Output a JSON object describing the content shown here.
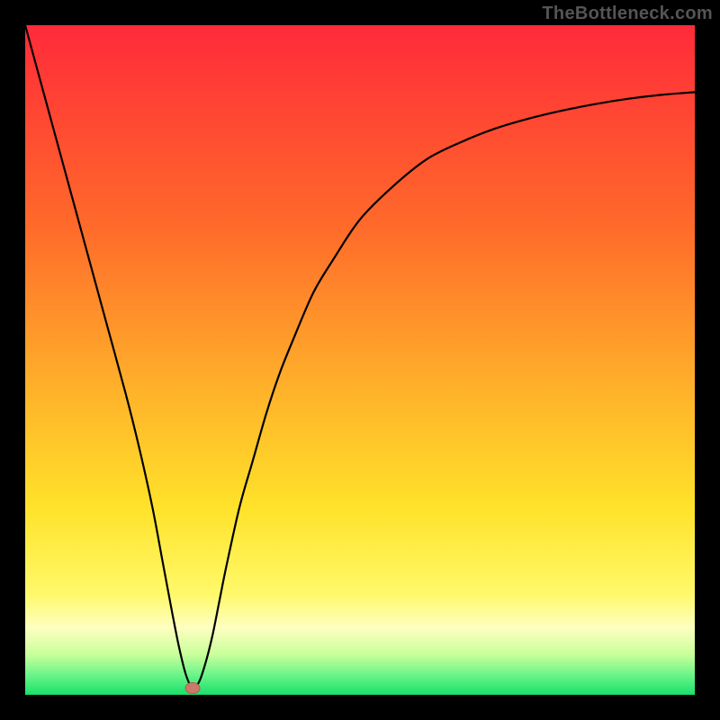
{
  "watermark": "TheBottleneck.com",
  "chart_data": {
    "type": "line",
    "title": "",
    "xlabel": "",
    "ylabel": "",
    "xlim": [
      0,
      100
    ],
    "ylim": [
      0,
      100
    ],
    "grid": false,
    "legend": false,
    "series": [
      {
        "name": "curve",
        "x": [
          0,
          3,
          6,
          9,
          12,
          15,
          17,
          19,
          20.5,
          22,
          23,
          24,
          25,
          26,
          27,
          28,
          29,
          30,
          32,
          34,
          36,
          38,
          40,
          43,
          46,
          50,
          55,
          60,
          65,
          70,
          75,
          80,
          85,
          90,
          95,
          100
        ],
        "y": [
          100,
          89,
          78,
          67,
          56,
          45,
          37,
          28,
          20,
          12,
          7,
          3,
          1,
          2,
          5,
          9,
          14,
          19,
          28,
          35,
          42,
          48,
          53,
          60,
          65,
          71,
          76,
          80,
          82.5,
          84.5,
          86,
          87.2,
          88.2,
          89,
          89.6,
          90
        ]
      }
    ],
    "marker": {
      "x": 25,
      "y": 1
    },
    "background": {
      "type": "vertical-gradient",
      "stops": [
        {
          "offset": 0.0,
          "color": "#ff2a3a"
        },
        {
          "offset": 0.3,
          "color": "#ff6a2a"
        },
        {
          "offset": 0.55,
          "color": "#ffb32a"
        },
        {
          "offset": 0.72,
          "color": "#ffe22a"
        },
        {
          "offset": 0.85,
          "color": "#fff96a"
        },
        {
          "offset": 0.9,
          "color": "#fdffc0"
        },
        {
          "offset": 0.94,
          "color": "#c8ff9a"
        },
        {
          "offset": 0.97,
          "color": "#6cf58a"
        },
        {
          "offset": 1.0,
          "color": "#19e06a"
        }
      ]
    }
  }
}
